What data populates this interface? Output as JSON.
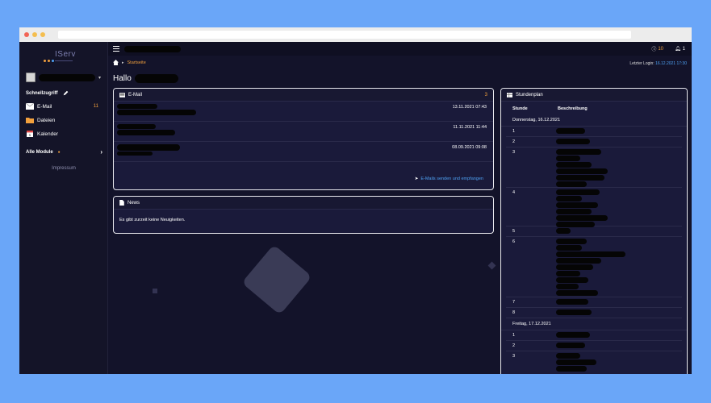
{
  "sidebar": {
    "quick_access_label": "Schnellzugriff",
    "items": [
      {
        "label": "E-Mail",
        "count": "11",
        "icon": "mail-icon"
      },
      {
        "label": "Dateien",
        "count": "",
        "icon": "folder-icon"
      },
      {
        "label": "Kalender",
        "count": "",
        "icon": "calendar-icon"
      }
    ],
    "all_modules_label": "Alle Module",
    "impressum_label": "Impressum"
  },
  "topbar": {
    "info_count": "10",
    "bell_count": "1"
  },
  "breadcrumb": {
    "current": "Startseite"
  },
  "last_login": {
    "label": "Letzter Login:",
    "value": "16.12.2021 17:30"
  },
  "greeting": "Hallo",
  "email_panel": {
    "title": "E-Mail",
    "count": "3",
    "rows": [
      {
        "date": "13.11.2021 07:43"
      },
      {
        "date": "11.11.2021 11:44"
      },
      {
        "date": "08.09.2021 09:08"
      }
    ],
    "footer_link": "E-Mails senden und empfangen"
  },
  "news_panel": {
    "title": "News",
    "empty_text": "Es gibt zurzeit keine Neuigkeiten."
  },
  "schedule_panel": {
    "title": "Stundenplan",
    "col_lesson": "Stunde",
    "col_description": "Beschreibung",
    "day1": "Donnerstag, 16.12.2021",
    "day1_lessons": [
      "1",
      "2",
      "3",
      "4",
      "5",
      "6",
      "7",
      "8"
    ],
    "day2": "Freitag, 17.12.2021",
    "day2_lessons": [
      "1",
      "2",
      "3"
    ]
  },
  "colors": {
    "accent_orange": "#f2a03d",
    "link_blue": "#4ea1f3",
    "background": "#13132a"
  }
}
